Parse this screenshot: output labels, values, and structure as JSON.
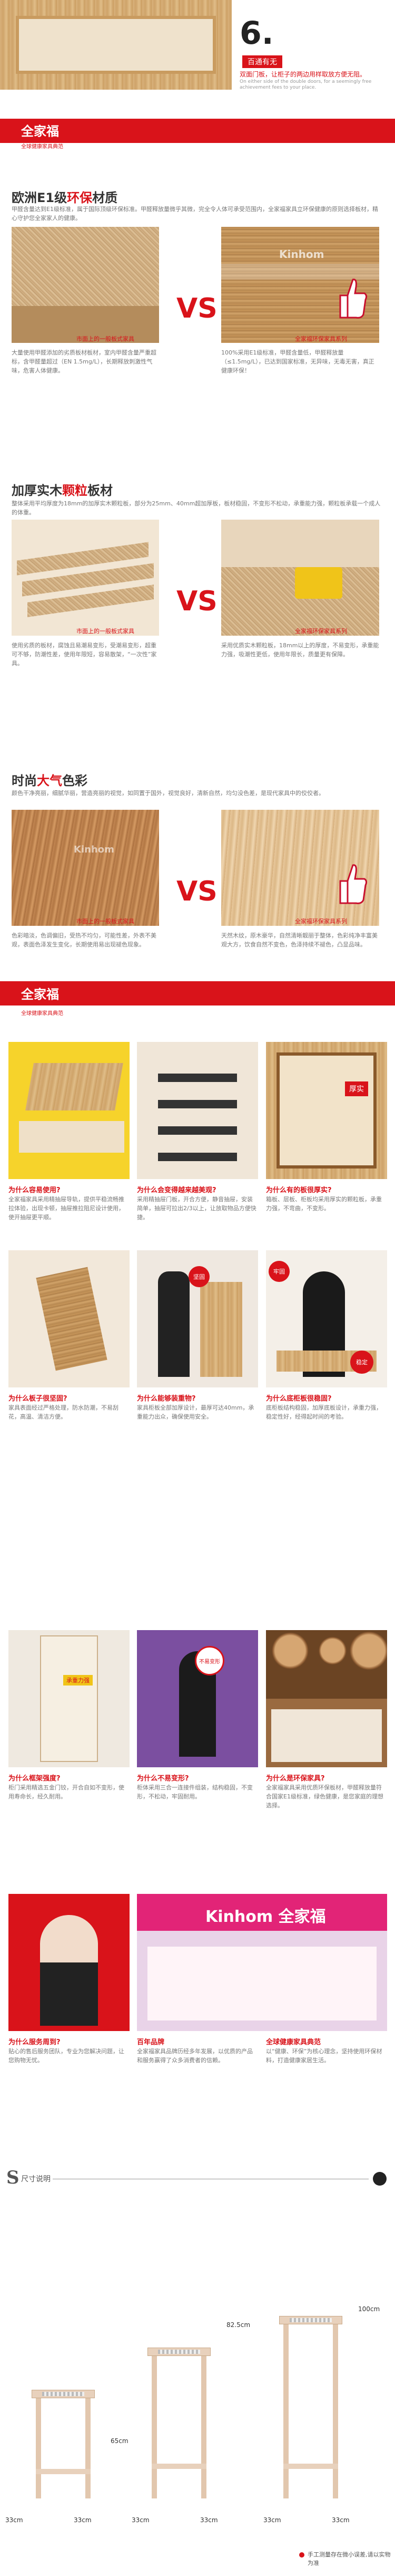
{
  "header": {
    "step_number": "6.",
    "subtitle_red": "百通有无",
    "desc_cn": "双面门板，让柜子的两边用样取放方便无阻。",
    "desc_en": "On either side of the double doors, for a seemingly free achievement fees to your place."
  },
  "brand_section_1": {
    "brand_name": "全家福",
    "brand_sub": "全球健康家具典范"
  },
  "eco_section": {
    "title_prefix": "欧洲E1级",
    "title_highlight": "环保",
    "title_suffix": "材质",
    "desc": "甲醛含量达到E1级标准，属于国际顶级环保标准。甲醛释放量微乎其微，完全令人体可承受范围内，全家福家具立环保健康的原则选择板材，精心守护您全家家人的健康。",
    "left_caption": "市面上的一般板式家具",
    "right_caption": "全家福环保家具系列",
    "left_text": "大量使用甲醛添加的劣质板材板材，室内甲醛含量严重超标，含甲醛量超过（EN 1.5mg/L），长期释放刺激性气味，危害人体健康。",
    "right_text": "100%采用E1级标准，甲醛含量低，甲醛释放量（≤1.5mg/L），已达到国家标准，无异味，无毒无害，真正健康环保！",
    "vs": "VS",
    "watermark": "Kinhom"
  },
  "board_section": {
    "title_prefix": "加厚实木",
    "title_highlight": "颗粒",
    "title_suffix": "板材",
    "desc": "整体采用平均厚度为18mm的加厚实木颗粒板，部分为25mm、40mm超加厚板，板材稳固，不变形不松动，承重能力强，颗粒板承载一个成人的体重。",
    "left_caption": "市面上的一般板式家具",
    "right_caption": "全家福环保家具系列",
    "left_text": "使用劣质的板材，腐蚀且易潮易变形，受潮易变形，超重可不够，防潮性差，使用年限短，容易散架，“一次性”家具。",
    "right_text": "采用优质实木颗粒板，18mm以上的厚度，不易变形，承重能力强，吸潮性更低，使用年限长，质量更有保障。",
    "vs": "VS"
  },
  "color_section": {
    "title_prefix": "时尚",
    "title_highlight": "大气",
    "title_suffix": "色彩",
    "desc": "颜色干净亮丽，细腻华丽，营造亮丽的视觉，如同置于国外，视觉良好，清新自然，均匀没色差，是现代家具中的佼佼者。",
    "left_caption": "市面上的一般板式家具",
    "right_caption": "全家福环保家具系列",
    "left_text": "色彩暗淡，色调偏旧，受热不均匀，可能性差，外表不美观，表面色泽发生变化，长期使用易出现褪色现象。",
    "right_text": "天然木纹，原木豪华，自然清晰靓丽于整体，色彩纯净丰富美观大方，饮食自然不变色，色泽持续不褪色，凸显品味。",
    "vs": "VS",
    "watermark": "Kinhom"
  },
  "brand_section_2": {
    "brand_name": "全家福",
    "brand_sub": "全球健康家具典范"
  },
  "features": [
    {
      "q": "为什么容易使用?",
      "text": "全家福家具采用精抽屉导轨，提供平稳流畅推拉体验，出现卡顿，抽屉推拉阻尼设计使用，使开抽屉更平顺。"
    },
    {
      "q": "为什么会变得越来越美观?",
      "text": "采用精抽屉门板，开合方便，静音抽屉，安装简单，抽屉可拉出2/3以上，让放取物品方便快捷。"
    },
    {
      "q": "为什么有的板很厚实?",
      "text": "箱板、层板、柜板均采用厚实的颗粒板，承重力强，不弯曲，不变形。"
    },
    {
      "q": "为什么板子很坚固?",
      "text": "家具表面经过严格处理，防水防潮，不易刮花，高温、清洁方便。"
    },
    {
      "q": "为什么能够装重物?",
      "text": "家具柜板全部加厚设计，最厚可达40mm，承重能力出众，确保使用安全。"
    },
    {
      "q": "为什么底柜板很稳固?",
      "text": "底柜板结构稳固，加厚底板设计，承重力强，稳定性好，经得起时间的考验。"
    },
    {
      "q": "为什么框架强度?",
      "text": "柜门采用精选五金门铰，开合自如不变形，使用寿命长，经久耐用。"
    },
    {
      "q": "为什么不易变形?",
      "text": "柜体采用三合一连接件组装，结构稳固，不变形，不松动，牢固耐用。"
    },
    {
      "q": "为什么是环保家具?",
      "text": "全家福家具采用优质环保板材，甲醛释放量符合国家E1级标准，绿色健康，是您家庭的理想选择。"
    },
    {
      "q": "为什么服务周到?",
      "text": "贴心的售后服务团队，专业为您解决问题，让您购物无忧。"
    },
    {
      "q": "百年品牌",
      "text": "全家福家具品牌历经多年发展，以优质的产品和服务赢得了众多消费者的信赖。"
    },
    {
      "q": "全球健康家具典范",
      "text": "以“健康、环保”为核心理念，坚持使用环保材料，打造健康家居生活。"
    }
  ],
  "features_image_labels": {
    "thick": "厚实",
    "strong": "坚固",
    "firm": "牢固",
    "stable": "稳定",
    "load": "承重力强",
    "no_deform": "不易变形"
  },
  "store": {
    "sign": "Kinhom 全家福"
  },
  "size_section": {
    "title": "S",
    "title_text": "尺寸说明",
    "note": "手工测量存在微小误差,请以实物为准",
    "items": [
      {
        "height": "65cm",
        "width": "33cm",
        "depth": "33cm"
      },
      {
        "height": "82.5cm",
        "width": "33cm",
        "depth": "33cm"
      },
      {
        "height": "100cm",
        "width": "33cm",
        "depth": "33cm"
      }
    ]
  }
}
